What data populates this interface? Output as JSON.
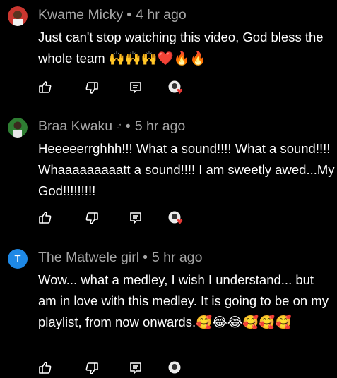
{
  "comments": [
    {
      "author": "Kwame Micky",
      "time": "4 hr ago",
      "text": "Just can't stop watching this video, God bless the whole team",
      "emojis": "🙌🙌🙌❤️🔥🔥",
      "avatar": "photo"
    },
    {
      "author": "Braa Kwaku",
      "gender_symbol": "♂",
      "time": "5 hr ago",
      "text": "Heeeeerrghhh!!! What a sound!!!! What a sound!!!! Whaaaaaaaaatt a sound!!!! I am sweetly awed...My God!!!!!!!!!",
      "avatar": "photo"
    },
    {
      "author": "The Matwele girl",
      "time": "5 hr ago",
      "text": "Wow... what a medley, I wish I understand... but am in love with this medley. It is going to be on my playlist, from now onwards.",
      "emojis": "🥰😂😂🥰🥰🥰",
      "avatar_letter": "T",
      "avatar_color": "#1e88e5"
    }
  ],
  "separator": "•",
  "icons": [
    "thumbs-up-icon",
    "thumbs-down-icon",
    "reply-icon",
    "creator-heart-icon"
  ]
}
